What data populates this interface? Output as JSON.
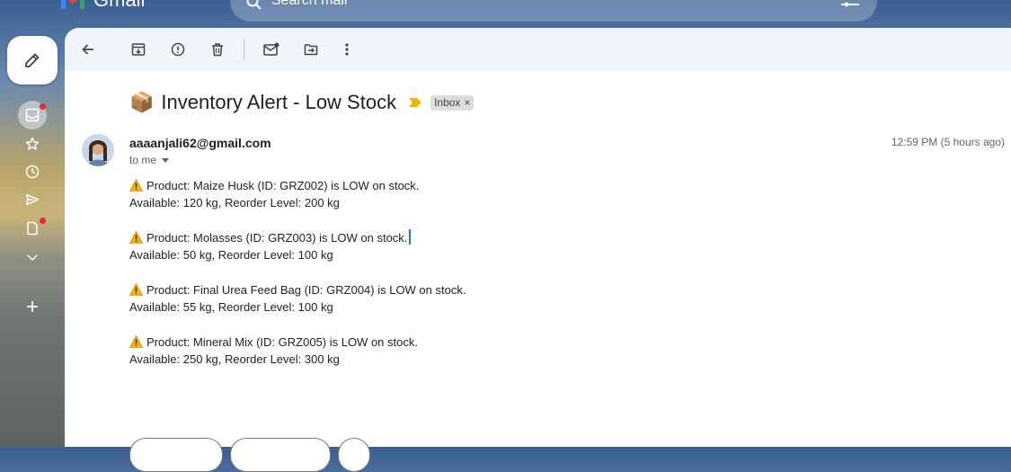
{
  "header": {
    "app_name": "Gmail",
    "search_placeholder": "Search mail"
  },
  "email": {
    "subject_emoji": "📦",
    "subject": "Inventory Alert - Low Stock",
    "label": "Inbox",
    "label_remove": "×",
    "sender": "aaaanjali62@gmail.com",
    "recipient": "to me",
    "timestamp": "12:59 PM (5 hours ago)",
    "alerts": [
      {
        "line1": "Product: Maize Husk (ID: GRZ002) is LOW on stock.",
        "line2": "Available: 120 kg, Reorder Level: 200 kg"
      },
      {
        "line1": "Product: Molasses (ID: GRZ003) is LOW on stock.",
        "line2": "Available: 50 kg, Reorder Level: 100 kg"
      },
      {
        "line1": "Product: Final Urea Feed Bag (ID: GRZ004) is LOW on stock.",
        "line2": "Available: 55 kg, Reorder Level: 100 kg"
      },
      {
        "line1": "Product: Mineral Mix (ID: GRZ005) is LOW on stock.",
        "line2": "Available: 250 kg, Reorder Level: 300 kg"
      }
    ]
  },
  "icons": {
    "menu": "menu-icon",
    "compose": "pencil-icon",
    "inbox": "inbox-icon",
    "starred": "star-icon",
    "snoozed": "clock-icon",
    "sent": "send-icon",
    "drafts": "draft-icon",
    "more": "chevron-down-icon",
    "new_label": "plus-icon",
    "back": "arrow-left-icon",
    "archive": "archive-icon",
    "spam": "report-icon",
    "delete": "trash-icon",
    "mark_unread": "mail-unread-icon",
    "move_to": "folder-move-icon",
    "more_options": "more-vert-icon",
    "importance": "importance-marker-icon",
    "warning": "warning-icon"
  },
  "colors": {
    "accent": "#1a73e8",
    "notification_dot": "#d93025",
    "importance_marker": "#f4b400"
  }
}
